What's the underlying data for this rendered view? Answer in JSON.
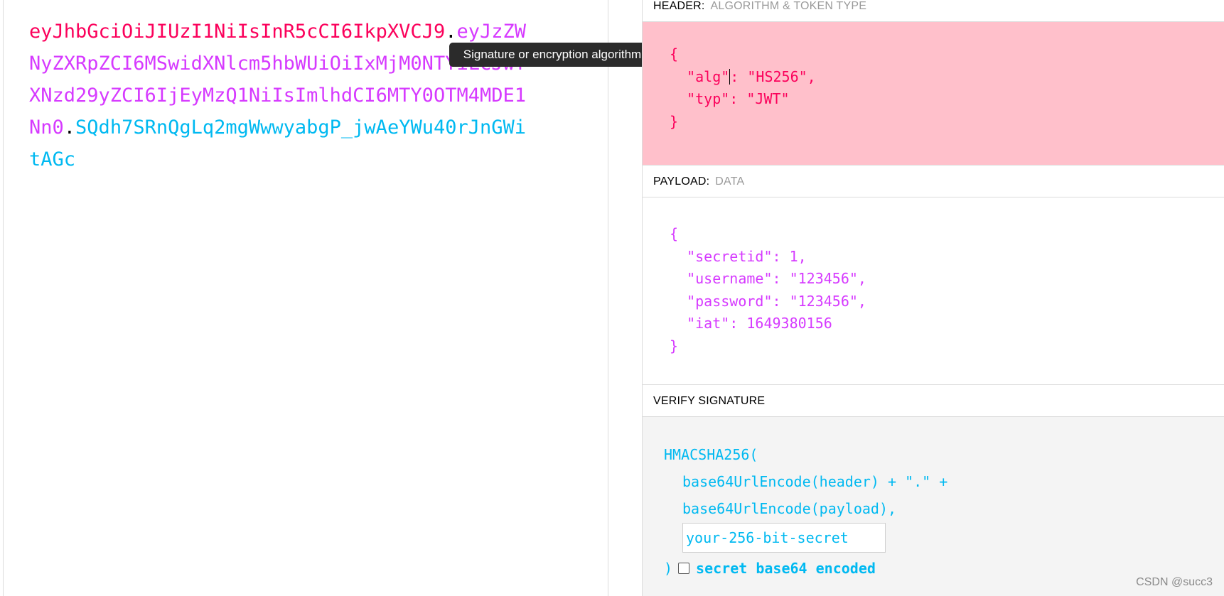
{
  "encoded": {
    "header_part": "eyJhbGciOiJIUzI1NiIsInR5cCI6IkpXVCJ9",
    "payload_part": "eyJzZWNyZXRpZCI6MSwidXNlcm5hbWUiOiIxMjM0NTYiLCJwYXNzd29yZCI6IjEyMzQ1NiIsImlhdCI6MTY0OTM4MDE1Nn0",
    "signature_part": "SQdh7SRnQgLq2mgWwwyabgP_jwAeYWu40rJnGWitAGc",
    "dot": "."
  },
  "tooltip": {
    "text": "Signature or encryption algorithm"
  },
  "header_section": {
    "title": "HEADER:",
    "subtitle": "ALGORITHM & TOKEN TYPE",
    "lines": {
      "open": "{",
      "alg_key": "  \"alg\"",
      "alg_rest": ": \"HS256\",",
      "typ": "  \"typ\": \"JWT\"",
      "close": "}"
    }
  },
  "payload_section": {
    "title": "PAYLOAD:",
    "subtitle": "DATA",
    "json_text": "{\n  \"secretid\": 1,\n  \"username\": \"123456\",\n  \"password\": \"123456\",\n  \"iat\": 1649380156\n}"
  },
  "verify_section": {
    "title": "VERIFY SIGNATURE",
    "fn_line": "HMACSHA256(",
    "line_header": "base64UrlEncode(header) + \".\" +",
    "line_payload": "base64UrlEncode(payload),",
    "secret_placeholder": "your-256-bit-secret",
    "close_paren": ")",
    "checkbox_label": "secret base64 encoded",
    "checkbox_checked": false
  },
  "watermark": "CSDN @succ3",
  "colors": {
    "header": "#fb015b",
    "payload": "#d63aff",
    "signature": "#00b9f1",
    "header_bg": "#ffc0cb",
    "verify_bg": "#f4f4f4"
  }
}
